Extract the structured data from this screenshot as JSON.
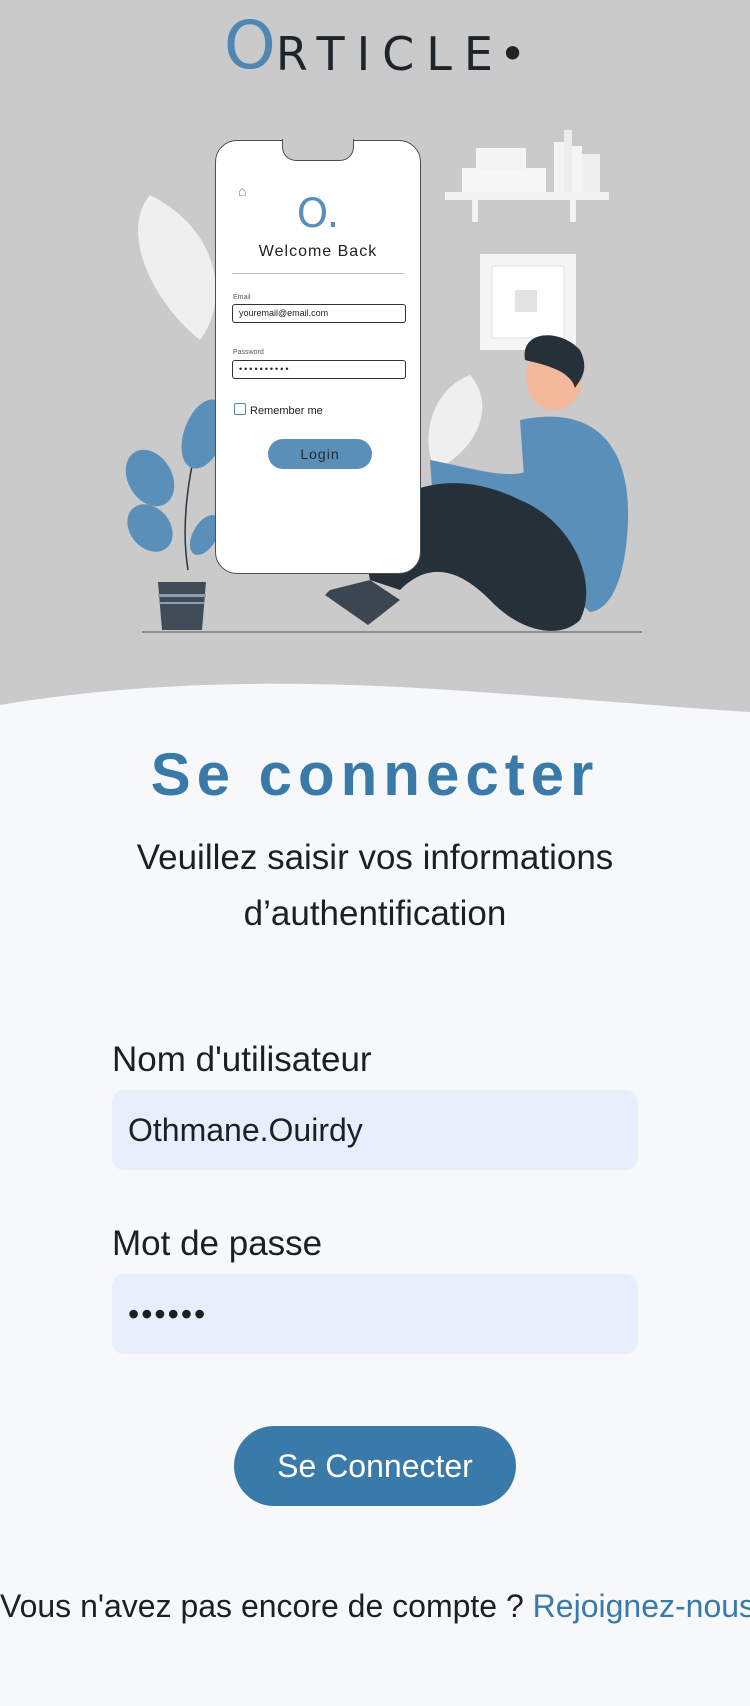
{
  "brand": {
    "initial": "O",
    "rest": "RTICLE",
    "dot": "•"
  },
  "illustration": {
    "phone": {
      "logo": "O.",
      "welcome": "Welcome Back",
      "email_label": "Email",
      "email_value": "youremail@email.com",
      "password_label": "Password",
      "password_value": "••••••••••",
      "remember_label": "Remember me",
      "login_label": "Login"
    }
  },
  "page": {
    "title": "Se connecter",
    "subtitle": "Veuillez saisir vos informations d’authentification"
  },
  "form": {
    "username_label": "Nom d'utilisateur",
    "username_value": "Othmane.Ouirdy",
    "password_label": "Mot de passe",
    "password_value": "••••••",
    "submit_label": "Se Connecter"
  },
  "footer": {
    "text": "Vous n'avez pas encore de compte ?",
    "link": "Rejoignez-nous"
  },
  "colors": {
    "accent": "#3a7aa8",
    "input_bg": "#e8effc",
    "hero_bg": "#cacaca"
  }
}
